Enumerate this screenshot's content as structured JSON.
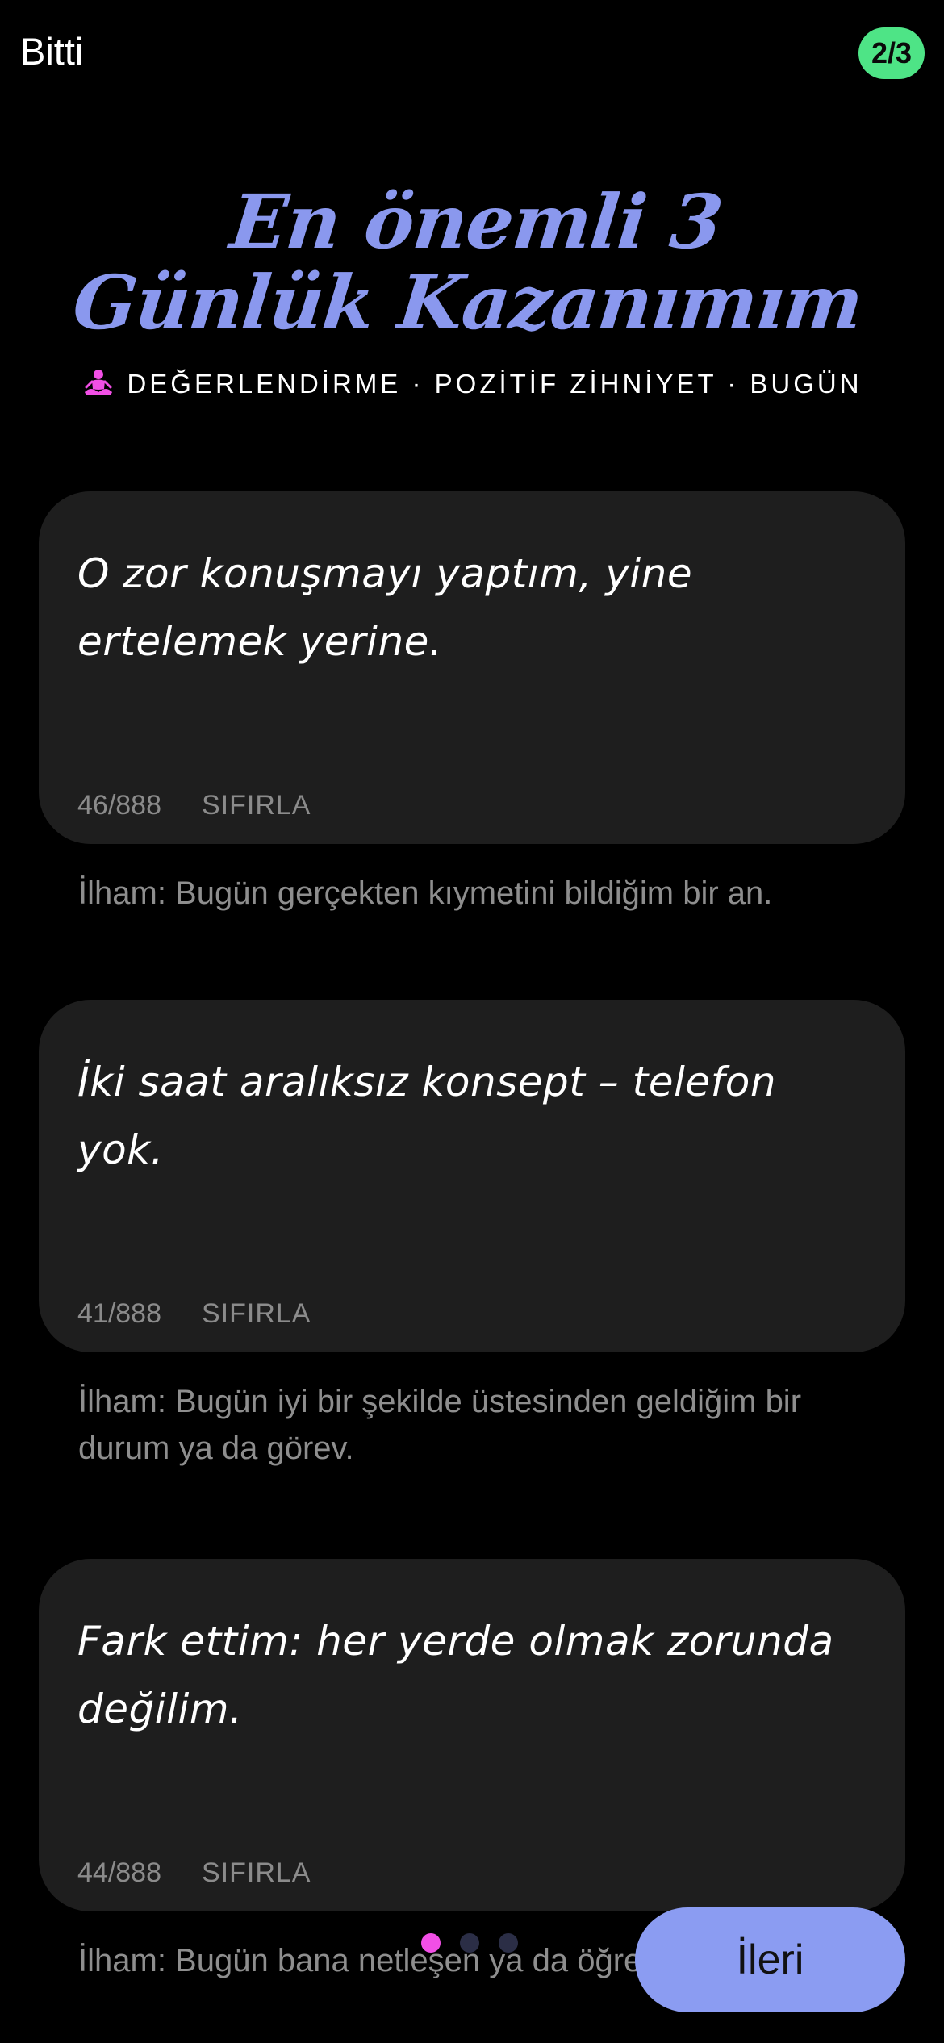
{
  "header": {
    "done_label": "Bitti",
    "step_badge": "2/3"
  },
  "title": {
    "line1": "En önemli 3",
    "line2": "Günlük Kazanımım"
  },
  "subtitle": {
    "icon": "meditation-icon",
    "icon_color": "#f24fe6",
    "text": "DEĞERLENDİRME · POZİTİF ZİHNİYET · BUGÜN"
  },
  "entries": [
    {
      "text": "O zor konuşmayı yaptım, yine ertelemek yerine.",
      "count": "46/888",
      "reset_label": "SIFIRLA",
      "hint": "İlham: Bugün gerçekten kıymetini bildiğim bir an."
    },
    {
      "text": "İki saat aralıksız konsept – telefon yok.",
      "count": "41/888",
      "reset_label": "SIFIRLA",
      "hint": "İlham: Bugün iyi bir şekilde üstesinden geldiğim bir durum ya da görev."
    },
    {
      "text": "Fark ettim: her yerde olmak zorunda değilim.",
      "count": "44/888",
      "reset_label": "SIFIRLA",
      "hint": "İlham: Bugün bana netleşen ya da öğrendiğim bir şey."
    }
  ],
  "pagination": {
    "active_index": 0,
    "total": 3,
    "active_color": "#f24fe6",
    "inactive_color": "#2b2e46"
  },
  "footer": {
    "next_label": "İleri"
  },
  "colors": {
    "accent": "#8a98ee",
    "badge": "#4ee486",
    "card": "#1e1e1e",
    "button": "#8b9cf2"
  }
}
